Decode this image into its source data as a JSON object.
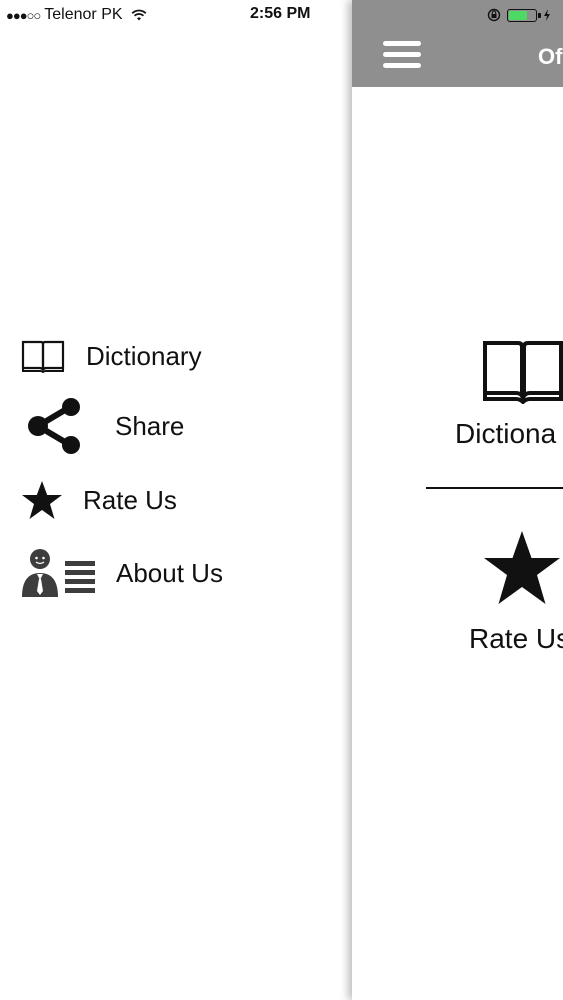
{
  "status_bar": {
    "signal": "●●●○○",
    "carrier": "Telenor PK",
    "time": "2:56 PM"
  },
  "drawer": {
    "items": [
      {
        "label": "Dictionary",
        "icon": "book-icon"
      },
      {
        "label": "Share",
        "icon": "share-icon"
      },
      {
        "label": "Rate Us",
        "icon": "star-icon"
      },
      {
        "label": "About Us",
        "icon": "about-us-icon"
      }
    ]
  },
  "main": {
    "title": "Of",
    "tiles": [
      {
        "label": "Dictiona",
        "icon": "book-icon"
      },
      {
        "label": "Rate Us",
        "icon": "star-icon"
      }
    ]
  },
  "colors": {
    "navbar": "#8f8f8f",
    "battery": "#4cd964"
  }
}
